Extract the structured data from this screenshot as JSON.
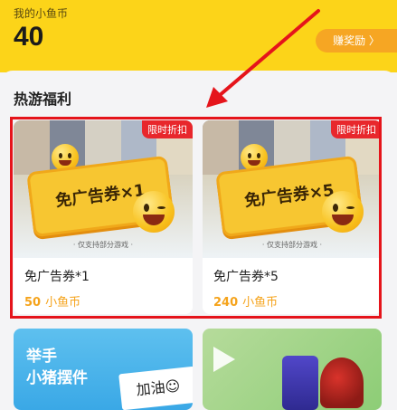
{
  "header": {
    "label": "我的小鱼币",
    "coins": "40",
    "earn_button": "赚奖励 〉"
  },
  "section": {
    "title": "热游福利"
  },
  "cards": [
    {
      "badge": "限时折扣",
      "ticket_text": "免广告券×1",
      "support_text": "· 仅支持部分游戏 ·",
      "name": "免广告券*1",
      "price": "50",
      "unit": "小鱼币"
    },
    {
      "badge": "限时折扣",
      "ticket_text": "免广告券×5",
      "support_text": "· 仅支持部分游戏 ·",
      "name": "免广告券*5",
      "price": "240",
      "unit": "小鱼币"
    }
  ],
  "bottom_cards": {
    "left": {
      "line1": "举手",
      "line2": "小猪摆件",
      "sign": "加油☺"
    }
  },
  "colors": {
    "header_bg": "#fcd419",
    "earn_button_bg": "#f6a623",
    "price": "#f5a31b",
    "badge": "#e8272c",
    "highlight_border": "#e5141b",
    "annotation_arrow": "#e5141b"
  }
}
